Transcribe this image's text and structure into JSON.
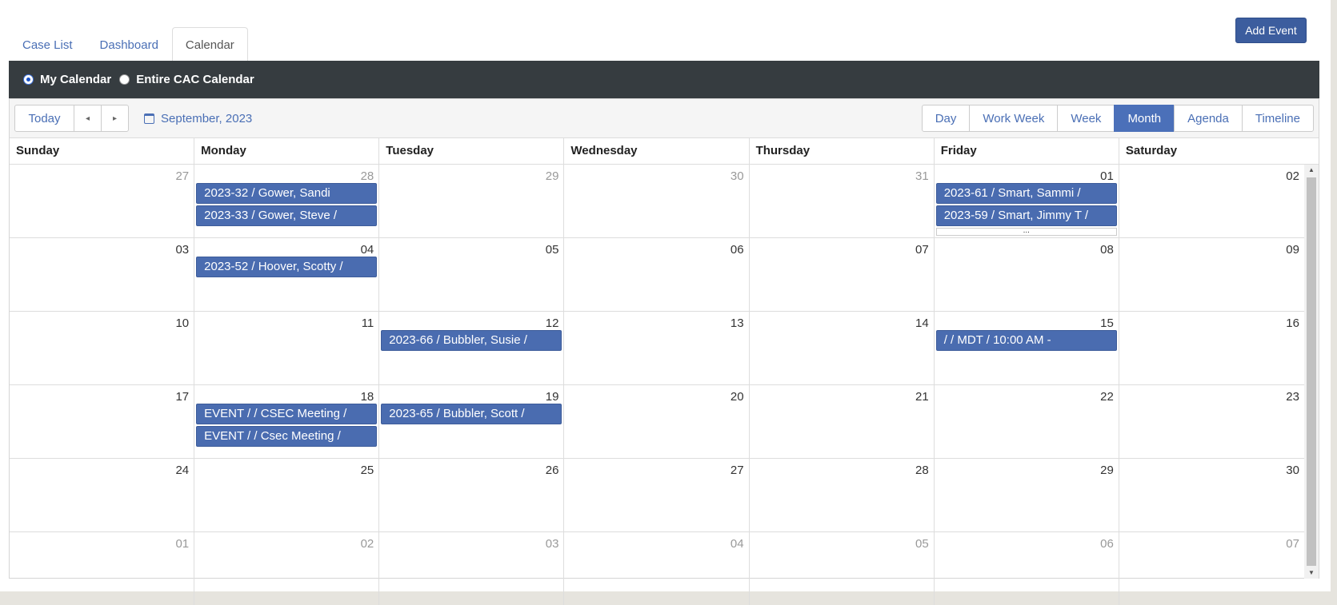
{
  "tabs": [
    {
      "label": "Case List",
      "active": false
    },
    {
      "label": "Dashboard",
      "active": false
    },
    {
      "label": "Calendar",
      "active": true
    }
  ],
  "add_event_label": "Add Event",
  "calendar_filter": {
    "options": [
      {
        "label": "My Calendar",
        "selected": true
      },
      {
        "label": "Entire CAC Calendar",
        "selected": false
      }
    ]
  },
  "toolbar": {
    "today_label": "Today",
    "prev_symbol": "◂",
    "next_symbol": "▸",
    "current_period": "September, 2023",
    "views": [
      "Day",
      "Work Week",
      "Week",
      "Month",
      "Agenda",
      "Timeline"
    ],
    "active_view": "Month"
  },
  "weekdays": [
    "Sunday",
    "Monday",
    "Tuesday",
    "Wednesday",
    "Thursday",
    "Friday",
    "Saturday"
  ],
  "weeks": [
    [
      {
        "day": "27",
        "other": true,
        "events": []
      },
      {
        "day": "28",
        "other": true,
        "events": [
          "2023-32 / Gower, Sandi",
          "2023-33 / Gower, Steve /"
        ]
      },
      {
        "day": "29",
        "other": true,
        "events": []
      },
      {
        "day": "30",
        "other": true,
        "events": []
      },
      {
        "day": "31",
        "other": true,
        "events": []
      },
      {
        "day": "01",
        "other": false,
        "events": [
          "2023-61 / Smart, Sammi /",
          "2023-59 / Smart, Jimmy T /"
        ],
        "more": "..."
      },
      {
        "day": "02",
        "other": false,
        "events": []
      }
    ],
    [
      {
        "day": "03",
        "other": false,
        "events": []
      },
      {
        "day": "04",
        "other": false,
        "events": [
          "2023-52 / Hoover, Scotty /"
        ]
      },
      {
        "day": "05",
        "other": false,
        "events": []
      },
      {
        "day": "06",
        "other": false,
        "events": []
      },
      {
        "day": "07",
        "other": false,
        "events": []
      },
      {
        "day": "08",
        "other": false,
        "events": []
      },
      {
        "day": "09",
        "other": false,
        "events": []
      }
    ],
    [
      {
        "day": "10",
        "other": false,
        "events": []
      },
      {
        "day": "11",
        "other": false,
        "events": []
      },
      {
        "day": "12",
        "other": false,
        "events": [
          "2023-66 / Bubbler, Susie /"
        ]
      },
      {
        "day": "13",
        "other": false,
        "events": []
      },
      {
        "day": "14",
        "other": false,
        "events": []
      },
      {
        "day": "15",
        "other": false,
        "events": [
          "/ / MDT / 10:00 AM -"
        ]
      },
      {
        "day": "16",
        "other": false,
        "events": []
      }
    ],
    [
      {
        "day": "17",
        "other": false,
        "events": []
      },
      {
        "day": "18",
        "other": false,
        "events": [
          "EVENT / / CSEC Meeting /",
          "EVENT / / Csec Meeting /"
        ]
      },
      {
        "day": "19",
        "other": false,
        "events": [
          "2023-65 / Bubbler, Scott /"
        ]
      },
      {
        "day": "20",
        "other": false,
        "events": []
      },
      {
        "day": "21",
        "other": false,
        "events": []
      },
      {
        "day": "22",
        "other": false,
        "events": []
      },
      {
        "day": "23",
        "other": false,
        "events": []
      }
    ],
    [
      {
        "day": "24",
        "other": false,
        "events": []
      },
      {
        "day": "25",
        "other": false,
        "events": []
      },
      {
        "day": "26",
        "other": false,
        "events": []
      },
      {
        "day": "27",
        "other": false,
        "events": []
      },
      {
        "day": "28",
        "other": false,
        "events": []
      },
      {
        "day": "29",
        "other": false,
        "events": []
      },
      {
        "day": "30",
        "other": false,
        "events": []
      }
    ],
    [
      {
        "day": "01",
        "other": true,
        "events": []
      },
      {
        "day": "02",
        "other": true,
        "events": []
      },
      {
        "day": "03",
        "other": true,
        "events": []
      },
      {
        "day": "04",
        "other": true,
        "events": []
      },
      {
        "day": "05",
        "other": true,
        "events": []
      },
      {
        "day": "06",
        "other": true,
        "events": []
      },
      {
        "day": "07",
        "other": true,
        "events": []
      }
    ]
  ],
  "colors": {
    "accent": "#4a6fb5",
    "event_bg": "#4a6cb0",
    "header_bar": "#363c40",
    "active_view_bg": "#4b70b9"
  }
}
